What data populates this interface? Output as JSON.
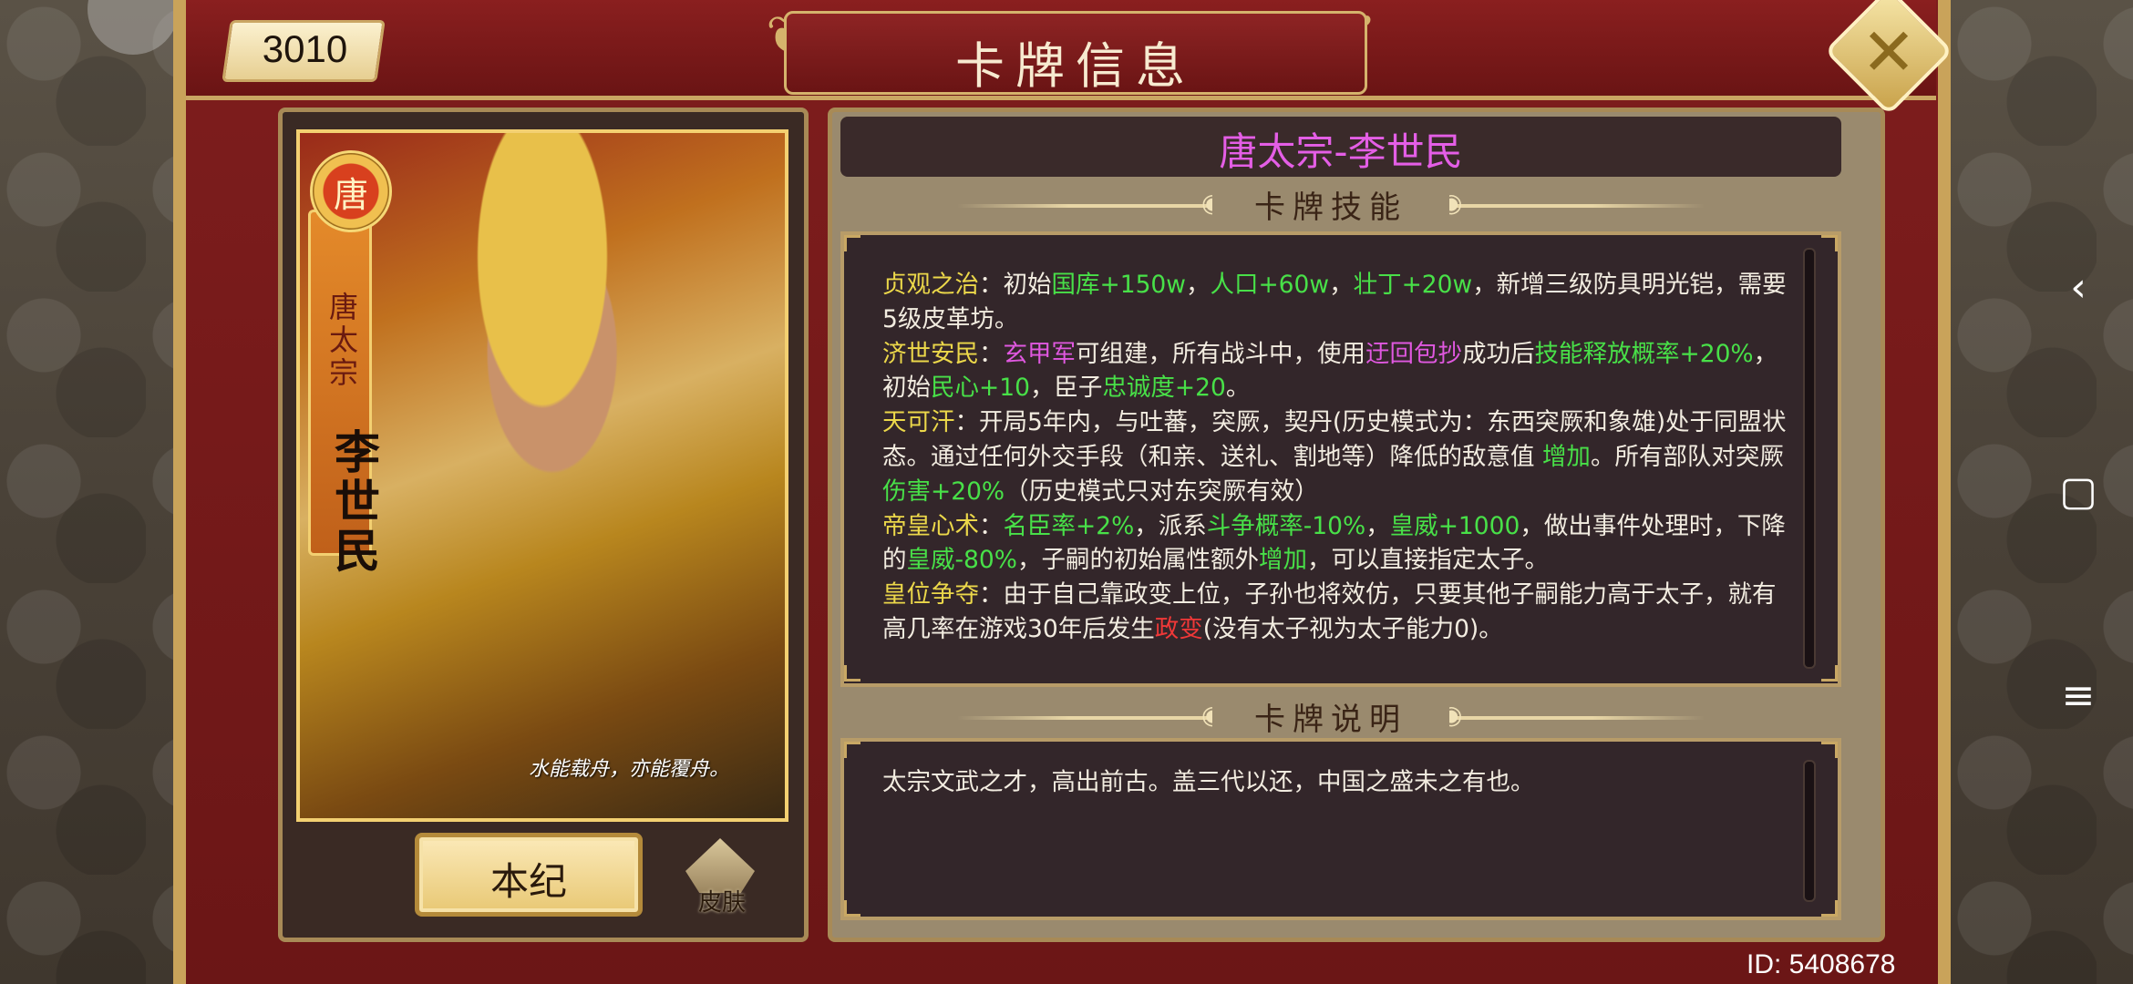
{
  "header": {
    "title": "卡牌信息",
    "card_number": "3010",
    "close_icon": "close-icon"
  },
  "card": {
    "emblem_char": "唐",
    "dynasty_vertical": "唐太宗",
    "name_vertical": "李世民",
    "quote": "水能载舟，亦能覆舟。"
  },
  "buttons": {
    "benji_label": "本纪",
    "skin_label": "皮肤"
  },
  "info": {
    "name": "唐太宗-李世民",
    "skills_heading": "卡牌技能",
    "desc_heading": "卡牌说明",
    "skills": [
      {
        "segments": [
          {
            "t": "贞观之治",
            "c": "y"
          },
          {
            "t": "：初始",
            "c": ""
          },
          {
            "t": "国库+150w",
            "c": "g"
          },
          {
            "t": "，",
            "c": ""
          },
          {
            "t": "人口+60w",
            "c": "g"
          },
          {
            "t": "，",
            "c": ""
          },
          {
            "t": "壮丁+20w",
            "c": "g"
          },
          {
            "t": "，新增三级防具明光铠，需要5级皮革坊。",
            "c": ""
          }
        ]
      },
      {
        "segments": [
          {
            "t": "济世安民",
            "c": "y"
          },
          {
            "t": "：",
            "c": ""
          },
          {
            "t": "玄甲军",
            "c": "p"
          },
          {
            "t": "可组建，所有战斗中，使用",
            "c": ""
          },
          {
            "t": "迂回包抄",
            "c": "p"
          },
          {
            "t": "成功后",
            "c": ""
          },
          {
            "t": "技能释放概率+20%",
            "c": "g"
          },
          {
            "t": "，初始",
            "c": ""
          },
          {
            "t": "民心+10",
            "c": "g"
          },
          {
            "t": "，臣子",
            "c": ""
          },
          {
            "t": "忠诚度+20",
            "c": "g"
          },
          {
            "t": "。",
            "c": ""
          }
        ]
      },
      {
        "segments": [
          {
            "t": "天可汗",
            "c": "y"
          },
          {
            "t": "：开局5年内，与吐蕃，突厥，契丹(历史模式为：东西突厥和象雄)处于同盟状态。通过任何外交手段（和亲、送礼、割地等）降低的敌意值 ",
            "c": ""
          },
          {
            "t": "增加",
            "c": "g"
          },
          {
            "t": "。所有部队对突厥",
            "c": ""
          },
          {
            "t": "伤害+20%",
            "c": "g"
          },
          {
            "t": "（历史模式只对东突厥有效）",
            "c": ""
          }
        ]
      },
      {
        "segments": [
          {
            "t": "帝皇心术",
            "c": "y"
          },
          {
            "t": "：",
            "c": ""
          },
          {
            "t": "名臣率+2%",
            "c": "g"
          },
          {
            "t": "，派系",
            "c": ""
          },
          {
            "t": "斗争概率-10%",
            "c": "g"
          },
          {
            "t": "，",
            "c": ""
          },
          {
            "t": "皇威+1000",
            "c": "g"
          },
          {
            "t": "，做出事件处理时，下降的",
            "c": ""
          },
          {
            "t": "皇威-80%",
            "c": "g"
          },
          {
            "t": "，子嗣的初始属性额外",
            "c": ""
          },
          {
            "t": "增加",
            "c": "g"
          },
          {
            "t": "，可以直接指定太子。",
            "c": ""
          }
        ]
      },
      {
        "segments": [
          {
            "t": "皇位争夺",
            "c": "y"
          },
          {
            "t": "：由于自己靠政变上位，子孙也将效仿，只要其他子嗣能力高于太子，就有高几率在游戏30年后发生",
            "c": ""
          },
          {
            "t": "政变",
            "c": "r"
          },
          {
            "t": "(没有太子视为太子能力0)。",
            "c": ""
          }
        ]
      }
    ],
    "description": "太宗文武之才，高出前古。盖三代以还，中国之盛未之有也。"
  },
  "footer": {
    "user_id": "ID: 5408678"
  },
  "system_nav": {
    "back": "‹",
    "home": "▢",
    "menu": "≡"
  }
}
